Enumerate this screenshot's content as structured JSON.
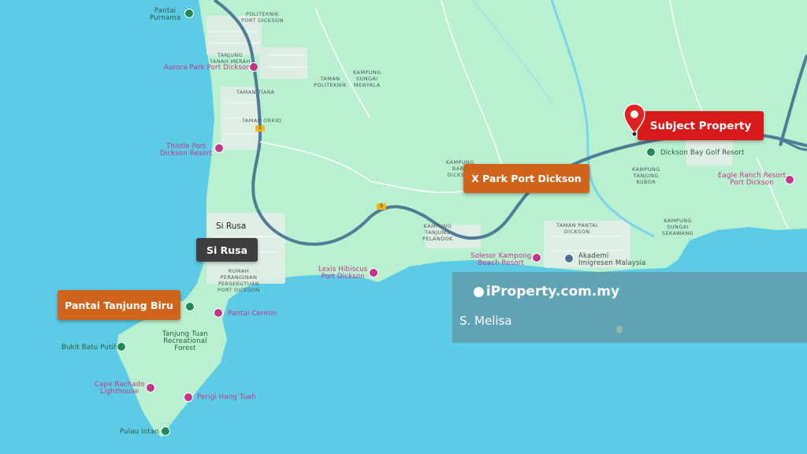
{
  "map": {
    "callouts": {
      "subject": "Subject Property",
      "xpark": "X Park Port Dickson",
      "pantai_biru": "Pantai Tanjung Biru",
      "si_rusa_box": "Si Rusa"
    },
    "pois": {
      "pantai_purnama": "Pantai\nPurnama",
      "aurora": "Aurora Park Port Dickson",
      "thistle": "Thistle Port\nDickson Resort",
      "lexis": "Lexis Hibiscus\nPort Dickson",
      "pantai_cermin": "Pantai Cermin",
      "bukit_batu_putih": "Bukit Batu Putih",
      "cape_rachado": "Cape Rachado\nLighthouse",
      "perigi": "Perigi Hang Tuah",
      "pulau_intan": "Pulau Intan",
      "solesor": "Solesor Kampong\nBeach Resort",
      "akademi": "Akademi\nImigresen Malaysia",
      "dickson_bay": "Dickson Bay Golf Resort",
      "eagle_ranch": "Eagle Ranch Resort\nPort Dickson",
      "tanjung_tuan": "Tanjung Tuan\nRecreational\nForest",
      "si_rusa": "Si Rusa"
    },
    "areas": {
      "politeknik": "POLITEKNIK\nPORT DICKSON",
      "tanjung_tanah_merah": "TANJUNG\nTANAH MERAH",
      "taman_politeknik": "TAMAN\nPOLITEKNIK",
      "kampung_sungai_menyala": "KAMPUNG\nSUNGAI\nMENYALA",
      "taman_tiara": "TAMAN TIARA",
      "taman_orkid": "TAMAN ORKID",
      "kampung_baru": "KAMPUNG\nBARU\nDICKSON",
      "kampung_tanjung_pelandok": "KAMPUNG\nTANJUNG\nPELANDOK",
      "taman_pantai_dickson": "TAMAN PANTAI\nDICKSON",
      "kampung_tanjung_kubor": "KAMPUNG\nTANJUNG\nKUBOR",
      "kampung_sungai_sekawang": "KAMPUNG\nSUNGAI\nSEKAWANG",
      "rumah_peranginan": "RUMAH\nPERANGINAN\nPERSEKUTUAN\nPORT DICKSON"
    },
    "route_number": "5",
    "watermark": {
      "logo": "iProperty.com.my",
      "credit": "S. Melisa"
    }
  }
}
